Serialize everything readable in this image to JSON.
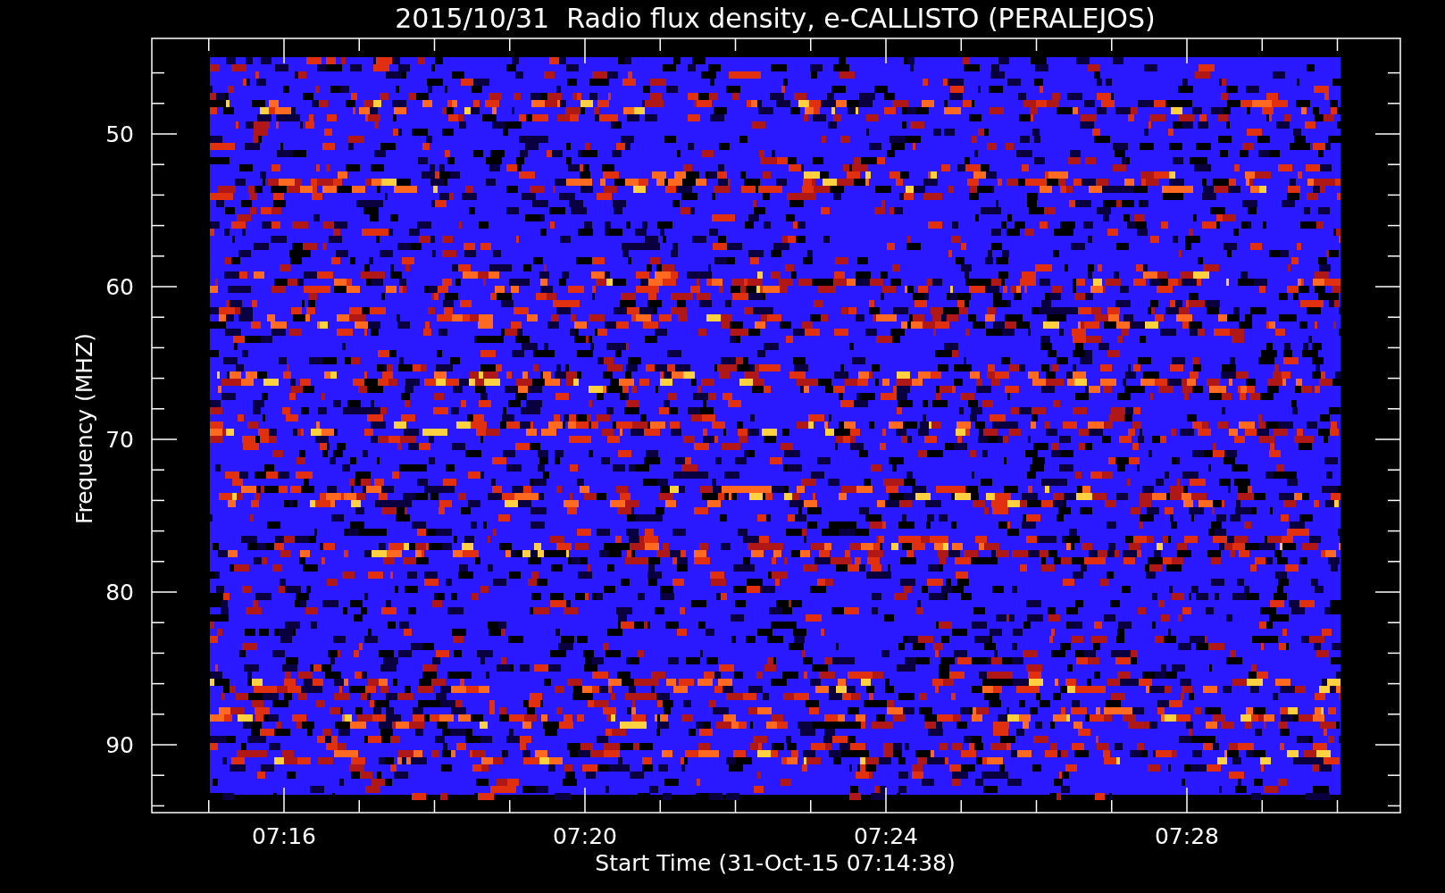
{
  "plot": {
    "title": "2015/10/31  Radio flux density, e-CALLISTO (PERALEJOS)",
    "y_axis": {
      "label": "Frequency (MHZ)",
      "ticks": [
        "50",
        "60",
        "70",
        "80",
        "90"
      ]
    },
    "x_axis": {
      "label": "Start Time (31-Oct-15 07:14:38)",
      "ticks": [
        "07:16",
        "07:20",
        "07:24",
        "07:28"
      ]
    }
  }
}
